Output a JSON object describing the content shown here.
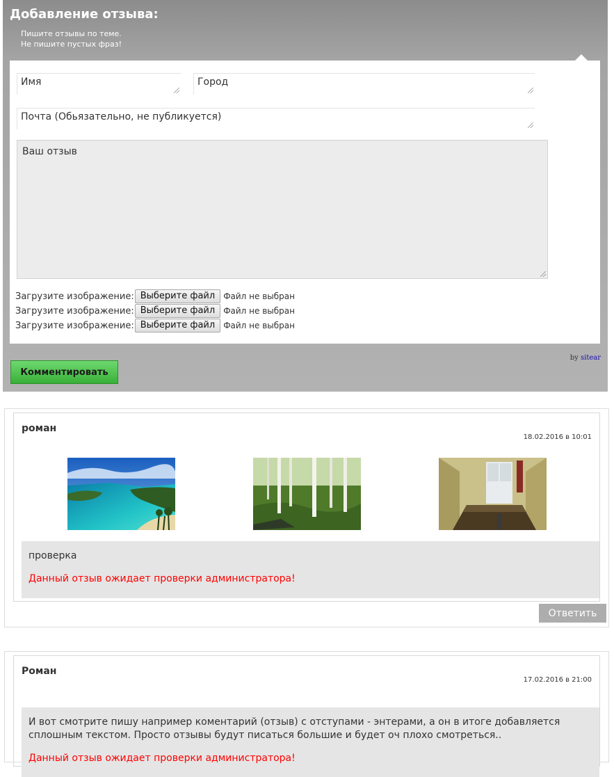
{
  "form": {
    "title": "Добавление отзыва:",
    "note_line1": "Пишите отзывы по теме.",
    "note_line2": "Не пишите пустых фраз!",
    "name_placeholder": "Имя",
    "city_placeholder": "Город",
    "email_placeholder": "Почта (Обьязательно, не публикуется)",
    "review_placeholder": "Ваш отзыв",
    "uploads": [
      {
        "label": "Загрузите изображение:",
        "button": "Выберите файл",
        "status": "Файл не выбран"
      },
      {
        "label": "Загрузите изображение:",
        "button": "Выберите файл",
        "status": "Файл не выбран"
      },
      {
        "label": "Загрузите изображение:",
        "button": "Выберите файл",
        "status": "Файл не выбран"
      }
    ],
    "by_prefix": "by",
    "by_link": "sitear",
    "submit_label": "Комментировать"
  },
  "reviews": [
    {
      "author": "роман",
      "date": "18.02.2016 в 10:01",
      "photos": [
        "beach-lagoon-photo",
        "birch-forest-photo",
        "room-interior-photo"
      ],
      "text": "проверка",
      "pending": "Данный отзыв ожидает проверки администратора!",
      "reply_label": "Ответить"
    },
    {
      "author": "Роман",
      "date": "17.02.2016 в 21:00",
      "text": "И вот смотрите пишу например коментарий (отзыв) с отступами - энтерами, а он в итоге добавляется сплошным текстом. Просто отзывы будут писаться большие и будет оч плохо смотреться..",
      "pending": "Данный отзыв ожидает проверки администратора!"
    }
  ],
  "colors": {
    "accent_green": "#38b038",
    "pending_red": "#ff0000",
    "panel_gray": "#a4a4a4"
  }
}
